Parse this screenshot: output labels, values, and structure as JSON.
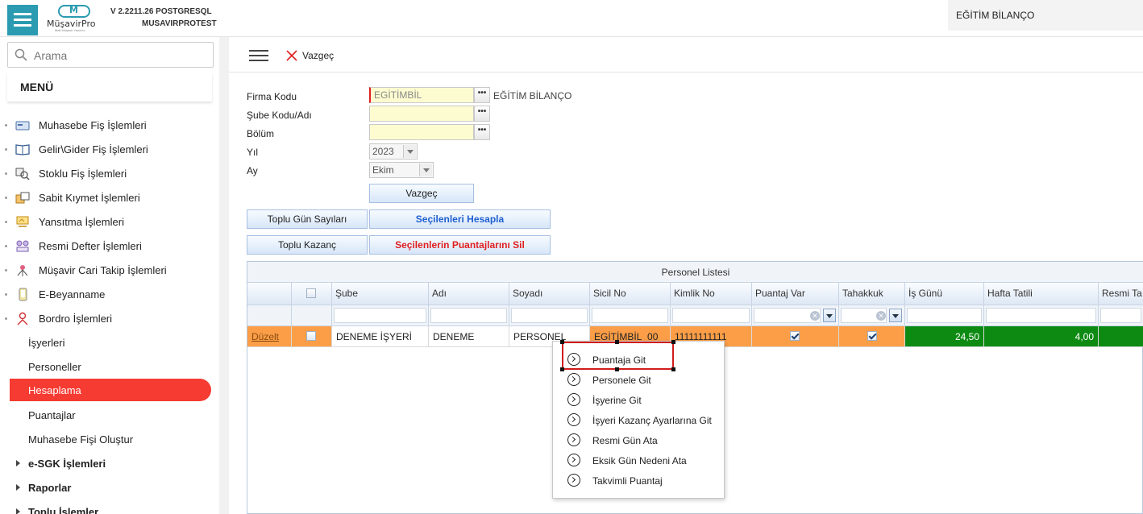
{
  "header": {
    "logo_text": "MüşavirPro",
    "logo_tagline": "Mali Müşavir Yazılımı",
    "version": "V 2.2211.26 POSTGRESQL",
    "database": "MUSAVIRPROTEST",
    "company": "EĞİTİM BİLANÇO"
  },
  "sidebar": {
    "search_placeholder": "Arama",
    "menu_title": "MENÜ",
    "items": [
      {
        "label": "Muhasebe Fiş İşlemleri",
        "icon": "receipt-icon"
      },
      {
        "label": "Gelir\\Gider Fiş İşlemleri",
        "icon": "book-icon"
      },
      {
        "label": "Stoklu Fiş İşlemleri",
        "icon": "stock-search-icon"
      },
      {
        "label": "Sabit Kıymet İşlemleri",
        "icon": "asset-icon"
      },
      {
        "label": "Yansıtma İşlemleri",
        "icon": "reflect-icon"
      },
      {
        "label": "Resmi Defter İşlemleri",
        "icon": "ledger-icon"
      },
      {
        "label": "Müşavir Cari Takip İşlemleri",
        "icon": "network-icon"
      },
      {
        "label": "E-Beyanname",
        "icon": "phone-icon"
      },
      {
        "label": "Bordro İşlemleri",
        "icon": "person-icon"
      }
    ],
    "sub_items": [
      {
        "label": "İşyerleri",
        "active": false
      },
      {
        "label": "Personeller",
        "active": false
      },
      {
        "label": "Hesaplama",
        "active": true
      },
      {
        "label": "Puantajlar",
        "active": false
      },
      {
        "label": "Muhasebe Fişi Oluştur",
        "active": false
      }
    ],
    "groups": [
      {
        "label": "e-SGK İşlemleri"
      },
      {
        "label": "Raporlar"
      },
      {
        "label": "Toplu İşlemler"
      }
    ]
  },
  "toolbar": {
    "cancel_label": "Vazgeç"
  },
  "form": {
    "firma_kodu_label": "Firma Kodu",
    "firma_kodu_value": "EGİTİMBİL",
    "firma_adi": "EĞİTİM BİLANÇO",
    "sube_label": "Şube Kodu/Adı",
    "bolum_label": "Bölüm",
    "yil_label": "Yıl",
    "yil_value": "2023",
    "ay_label": "Ay",
    "ay_value": "Ekim",
    "cancel_button": "Vazgeç",
    "dots": "•••"
  },
  "actions": {
    "toplu_gun": "Toplu Gün Sayıları",
    "hesapla": "Seçilenleri Hesapla",
    "toplu_kazanc": "Toplu Kazanç",
    "sil": "Seçilenlerin Puantajlarını Sil"
  },
  "grid": {
    "title": "Personel Listesi",
    "columns": [
      "Şube",
      "Adı",
      "Soyadı",
      "Sicil No",
      "Kimlik No",
      "Puantaj Var",
      "Tahakkuk",
      "İş Günü",
      "Hafta Tatili",
      "Resmi Ta"
    ],
    "row": {
      "edit_link": "Düzelt",
      "sube": "DENEME İŞYERİ",
      "adi": "DENEME",
      "soyadi": "PERSONEL",
      "sicil": "EGİTİMBİL_00",
      "kimlik": "11111111111",
      "puantaj_var": true,
      "tahakkuk": true,
      "is_gunu": "24,50",
      "hafta_tatili": "4,00"
    }
  },
  "context_menu": {
    "items": [
      "Puantaja Git",
      "Personele Git",
      "İşyerine Git",
      "İşyeri Kazanç Ayarlarına Git",
      "Resmi Gün Ata",
      "Eksik Gün Nedeni Ata",
      "Takvimli Puantaj"
    ]
  }
}
